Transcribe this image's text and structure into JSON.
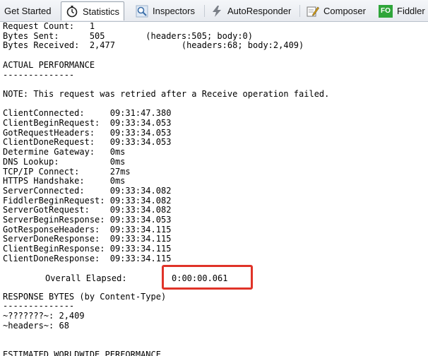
{
  "tabs": [
    {
      "label": "Get Started",
      "icon": "none",
      "active": false
    },
    {
      "label": "Statistics",
      "icon": "stopwatch-icon",
      "active": true
    },
    {
      "label": "Inspectors",
      "icon": "magnifier-icon",
      "active": false
    },
    {
      "label": "AutoResponder",
      "icon": "lightning-icon",
      "active": false
    },
    {
      "label": "Composer",
      "icon": "pencil-icon",
      "active": false
    },
    {
      "label": "Fiddler",
      "icon": "fo-badge-icon",
      "badge": "FO",
      "active": false
    }
  ],
  "colors": {
    "highlight_border": "#e03328",
    "fo_badge": "#2fa53a"
  },
  "stats_top": "Request Count:   1\nBytes Sent:      505        (headers:505; body:0)\nBytes Received:  2,477             (headers:68; body:2,409)\n\nACTUAL PERFORMANCE\n--------------\n\nNOTE: This request was retried after a Receive operation failed.\n\nClientConnected:     09:31:47.380\nClientBeginRequest:  09:33:34.053\nGotRequestHeaders:   09:33:34.053\nClientDoneRequest:   09:33:34.053\nDetermine Gateway:   0ms\nDNS Lookup:          0ms\nTCP/IP Connect:      27ms\nHTTPS Handshake:     0ms\nServerConnected:     09:33:34.082\nFiddlerBeginRequest: 09:33:34.082\nServerGotRequest:    09:33:34.082\nServerBeginResponse: 09:33:34.053\nGotResponseHeaders:  09:33:34.115\nServerDoneResponse:  09:33:34.115\nClientBeginResponse: 09:33:34.115\nClientDoneResponse:  09:33:34.115",
  "elapsed": {
    "label": "Overall Elapsed:",
    "value": "0:00:00.061"
  },
  "stats_bottom": "RESPONSE BYTES (by Content-Type)\n--------------\n~???????~: 2,409\n~headers~: 68\n\n\nESTIMATED WORLDWIDE PERFORMANCE"
}
